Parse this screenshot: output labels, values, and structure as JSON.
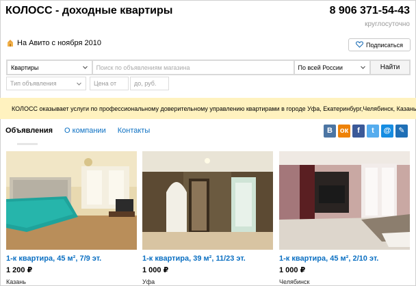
{
  "header": {
    "shop_name": "КОЛОСС - доходные квартиры",
    "phone": "8 906 371-54-43",
    "phone_note": "круглосуточно"
  },
  "meta": {
    "since_text": "На Авито с ноября 2010",
    "since_icon": "shop-badge-icon",
    "subscribe_label": "Подписаться",
    "subscribe_icon": "heart-icon"
  },
  "search": {
    "category_value": "Квартиры",
    "query_placeholder": "Поиск по объявлениям магазина",
    "region_value": "По всей России",
    "submit_label": "Найти"
  },
  "filters": {
    "type_placeholder": "Тип объявления",
    "price_from_placeholder": "Цена от",
    "price_to_placeholder": "до, руб."
  },
  "banner": {
    "text": "КОЛОСС оказывает услуги по профессиональному доверительному управлению квартирами в городе Уфа, Екатеринбург,Челябинск, Казань."
  },
  "tabs": [
    {
      "label": "Объявления",
      "active": true
    },
    {
      "label": "О компании",
      "active": false
    },
    {
      "label": "Контакты",
      "active": false
    }
  ],
  "share": [
    {
      "name": "vk-icon",
      "glyph": "В",
      "color": "#4c75a3"
    },
    {
      "name": "odnoklassniki-icon",
      "glyph": "ок",
      "color": "#ee8208"
    },
    {
      "name": "facebook-icon",
      "glyph": "f",
      "color": "#3b5998"
    },
    {
      "name": "twitter-icon",
      "glyph": "t",
      "color": "#55acee"
    },
    {
      "name": "mail-icon",
      "glyph": "@",
      "color": "#168de2"
    },
    {
      "name": "bookmark-icon",
      "glyph": "✎",
      "color": "#1f6fb6"
    }
  ],
  "listings": [
    {
      "title": "1-к квартира, 45 м², 7/9 эт.",
      "price": "1 200 ₽",
      "city": "Казань"
    },
    {
      "title": "1-к квартира, 39 м², 11/23 эт.",
      "price": "1 000 ₽",
      "city": "Уфа"
    },
    {
      "title": "1-к квартира, 45 м², 2/10 эт.",
      "price": "1 000 ₽",
      "city": "Челябинск"
    }
  ]
}
